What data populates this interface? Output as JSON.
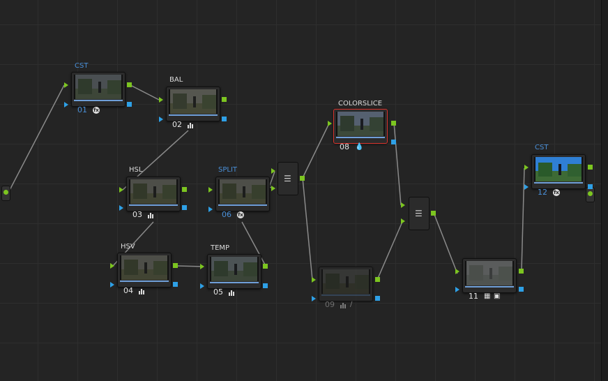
{
  "colors": {
    "green_pin": "#7cc520",
    "blue_pin": "#2ea0e6",
    "selected_border": "#d9332c",
    "label_blue": "#4a90d9"
  },
  "nodes": [
    {
      "id": "n01",
      "label": "CST",
      "number": "01",
      "label_color": "blue",
      "num_color": "blue",
      "icon": "fx-icon",
      "thumb": "dusk"
    },
    {
      "id": "n02",
      "label": "BAL",
      "number": "02",
      "label_color": "white",
      "num_color": "white",
      "icon": "bars-icon",
      "thumb": "dusk"
    },
    {
      "id": "n03",
      "label": "HSL",
      "number": "03",
      "label_color": "white",
      "num_color": "white",
      "icon": "bars-icon",
      "thumb": "dusk"
    },
    {
      "id": "n04",
      "label": "HSV",
      "number": "04",
      "label_color": "white",
      "num_color": "white",
      "icon": "bars-icon",
      "thumb": "dusk"
    },
    {
      "id": "n05",
      "label": "TEMP",
      "number": "05",
      "label_color": "white",
      "num_color": "white",
      "icon": "bars-icon",
      "thumb": "dusk"
    },
    {
      "id": "n06",
      "label": "SPLIT",
      "number": "06",
      "label_color": "blue",
      "num_color": "blue",
      "icon": "fx-icon",
      "thumb": "dusk"
    },
    {
      "id": "n08",
      "label": "COLORSLICE",
      "number": "08",
      "label_color": "white",
      "num_color": "white",
      "icon": "drop-icon",
      "thumb": "blue",
      "selected": true
    },
    {
      "id": "n09",
      "label": "",
      "number": "09",
      "label_color": "white",
      "num_color": "grey",
      "icon": "bars-picker-icon",
      "thumb": "dark",
      "dim": true
    },
    {
      "id": "n11",
      "label": "",
      "number": "11",
      "label_color": "white",
      "num_color": "white",
      "icon": "grid-camera-icon",
      "thumb": "grey",
      "dim": true
    },
    {
      "id": "n12",
      "label": "CST",
      "number": "12",
      "label_color": "blue",
      "num_color": "blue",
      "icon": "fx-icon",
      "thumb": "sky"
    }
  ],
  "layer_mixers": [
    {
      "id": "mix1",
      "icon": "layers-icon"
    },
    {
      "id": "mix2",
      "icon": "layers-icon"
    }
  ]
}
